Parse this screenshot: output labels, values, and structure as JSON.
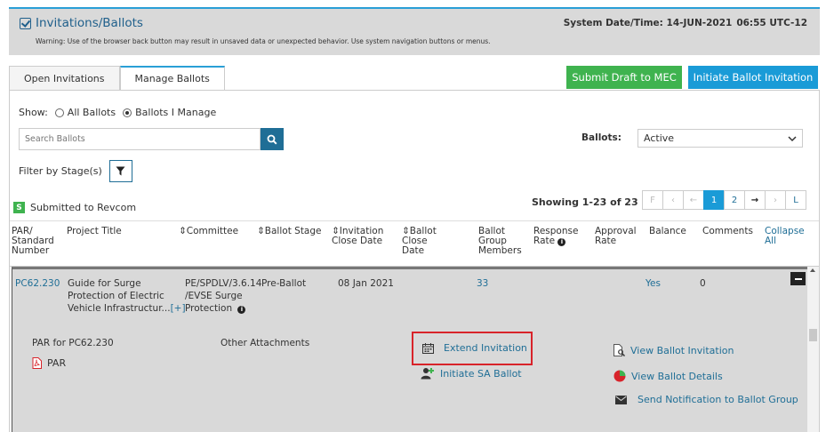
{
  "header": {
    "title": "Invitations/Ballots",
    "warning": "Warning: Use of the browser back button may result in unsaved data or unexpected behavior. Use system navigation buttons or menus.",
    "system_label": "System Date/Time: 14-JUN-2021",
    "system_time": "06:55 UTC-12"
  },
  "tabs": [
    {
      "label": "Open Invitations",
      "active": false
    },
    {
      "label": "Manage Ballots",
      "active": true
    }
  ],
  "actions": {
    "submit_draft": "Submit Draft to MEC",
    "initiate_invitation": "Initiate Ballot Invitation"
  },
  "show": {
    "label": "Show:",
    "options": [
      "All Ballots",
      "Ballots I Manage"
    ],
    "selected": "Ballots I Manage"
  },
  "search": {
    "placeholder": "Search Ballots"
  },
  "ballots_filter": {
    "label": "Ballots:",
    "value": "Active"
  },
  "filter_stage": {
    "label": "Filter by Stage(s)"
  },
  "legend": {
    "badge": "S",
    "label": "Submitted to Revcom"
  },
  "pagination": {
    "showing": "Showing 1-23 of 23",
    "buttons": [
      "F",
      "‹",
      "←",
      "1",
      "2",
      "→",
      "›",
      "L"
    ],
    "current": "1"
  },
  "table": {
    "headers": {
      "par": "PAR/ Standard Number",
      "title": "Project Title",
      "committee": "⇕Committee",
      "stage": "⇕Ballot Stage",
      "inv_close": "⇕Invitation Close Date",
      "ballot_close": "⇕Ballot Close Date",
      "members": "Ballot Group Members",
      "response": "Response Rate",
      "approval": "Approval Rate",
      "balance": "Balance",
      "comments": "Comments",
      "collapse": "Collapse All"
    },
    "row": {
      "par": "PC62.230",
      "title_l1": "Guide for Surge",
      "title_l2": "Protection of Electric",
      "title_l3": "Vehicle Infrastructur...",
      "more": "[+]",
      "committee_l1": "PE/SPDLV/3.6.14",
      "committee_l2": "/EVSE Surge",
      "committee_l3": "Protection",
      "stage": "Pre-Ballot",
      "inv_close": "08 Jan 2021",
      "ballot_close": "",
      "members": "33",
      "balance": "Yes",
      "comments": "0"
    },
    "detail": {
      "par_for": "PAR for PC62.230",
      "par_link": "PAR",
      "other_attachments": "Other Attachments",
      "extend": "Extend Invitation",
      "initiate_sa": "Initiate SA Ballot",
      "view_invitation": "View Ballot Invitation",
      "view_details": "View Ballot Details",
      "send_notification": "Send Notification to Ballot Group"
    }
  },
  "colors": {
    "accent": "#1a9bd7",
    "green": "#3fb34f",
    "link": "#1f6e96",
    "highlight": "#d8232a"
  }
}
